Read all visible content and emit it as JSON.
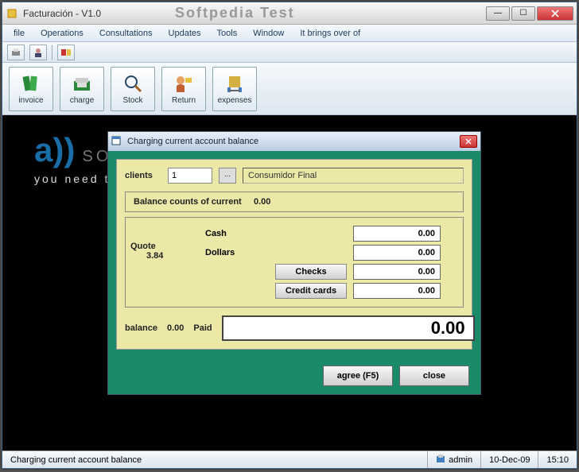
{
  "window": {
    "title": "Facturación - V1.0",
    "bg_watermark": "Softpedia Test"
  },
  "menu": [
    "file",
    "Operations",
    "Consultations",
    "Updates",
    "Tools",
    "Window",
    "It brings over of"
  ],
  "toolbar": {
    "invoice": "invoice",
    "charge": "charge",
    "stock": "Stock",
    "return": "Return",
    "expenses": "expenses"
  },
  "background": {
    "logo_arcs": "a))",
    "brand": "SOFTPEDIA",
    "tagline": "you need th"
  },
  "dialog": {
    "title": "Charging current account balance",
    "clients_label": "clients",
    "clients_value": "1",
    "client_name": "Consumidor Final",
    "balance_counts_label": "Balance counts of current",
    "balance_counts_value": "0.00",
    "quote_label": "Quote",
    "quote_value": "3.84",
    "cash_label": "Cash",
    "cash_value": "0.00",
    "dollars_label": "Dollars",
    "dollars_value": "0.00",
    "checks_label": "Checks",
    "checks_value": "0.00",
    "credit_label": "Credit cards",
    "credit_value": "0.00",
    "balance_label": "balance",
    "balance_value": "0.00",
    "paid_label": "Paid",
    "paid_value": "0.00",
    "agree_label": "agree (F5)",
    "close_label": "close"
  },
  "statusbar": {
    "message": "Charging current account balance",
    "user": "admin",
    "date": "10-Dec-09",
    "time": "15:10"
  }
}
